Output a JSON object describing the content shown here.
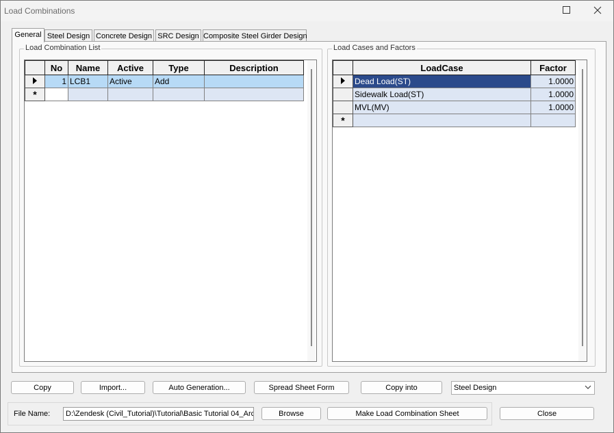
{
  "window": {
    "title": "Load Combinations"
  },
  "tabs": [
    {
      "label": "General",
      "active": true
    },
    {
      "label": "Steel Design"
    },
    {
      "label": "Concrete Design"
    },
    {
      "label": "SRC Design"
    },
    {
      "label": "Composite Steel Girder Design"
    }
  ],
  "combination_list": {
    "group_label": "Load Combination List",
    "columns": [
      "No",
      "Name",
      "Active",
      "Type",
      "Description"
    ],
    "rows": [
      {
        "marker": "current",
        "no": "1",
        "name": "LCB1",
        "active": "Active",
        "type": "Add",
        "description": ""
      },
      {
        "marker": "new",
        "no": "",
        "name": "",
        "active": "",
        "type": "",
        "description": ""
      }
    ]
  },
  "load_cases": {
    "group_label": "Load Cases and Factors",
    "columns": [
      "LoadCase",
      "Factor"
    ],
    "rows": [
      {
        "marker": "current",
        "loadcase": "Dead Load(ST)",
        "factor": "1.0000"
      },
      {
        "marker": "",
        "loadcase": "Sidewalk Load(ST)",
        "factor": "1.0000"
      },
      {
        "marker": "",
        "loadcase": "MVL(MV)",
        "factor": "1.0000"
      },
      {
        "marker": "new",
        "loadcase": "",
        "factor": ""
      }
    ]
  },
  "buttons": {
    "copy": "Copy",
    "import": "Import...",
    "auto_generation": "Auto Generation...",
    "spread_sheet": "Spread Sheet Form",
    "copy_into": "Copy into",
    "browse": "Browse",
    "make_sheet": "Make Load Combination Sheet",
    "close": "Close"
  },
  "copy_into_select": {
    "value": "Steel Design"
  },
  "file": {
    "label": "File Name:",
    "value": "D:\\Zendesk (Civil_Tutorial)\\Tutorial\\Basic Tutorial 04_Arc"
  },
  "colors": {
    "selected_row": "#b7daf6",
    "selected_cell": "#2b4a8b",
    "grid_row": "#dde6f4"
  },
  "icons": {
    "row_current": "right-triangle-icon",
    "row_new": "asterisk-icon",
    "maximize": "maximize-icon",
    "close": "close-icon",
    "dropdown": "chevron-down-icon"
  }
}
